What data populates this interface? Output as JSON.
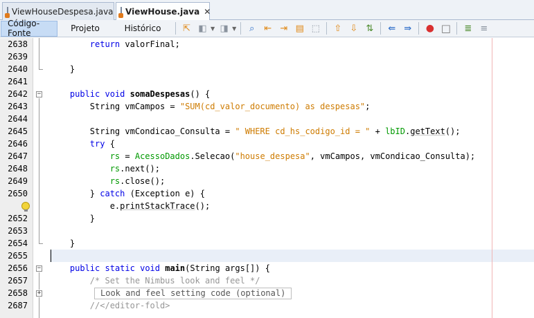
{
  "tabs": [
    {
      "label": "ViewHouseDespesa.java",
      "active": false
    },
    {
      "label": "ViewHouse.java",
      "active": true
    }
  ],
  "view_tabs": [
    "Código-Fonte",
    "Projeto",
    "Histórico"
  ],
  "code_lines": [
    {
      "num": "2638",
      "text": "        return valorFinal;"
    },
    {
      "num": "2639",
      "text": ""
    },
    {
      "num": "2640",
      "text": "    }"
    },
    {
      "num": "2641",
      "text": ""
    },
    {
      "num": "2642",
      "text": "    public void somaDespesas() {"
    },
    {
      "num": "2643",
      "text": "        String vmCampos = \"SUM(cd_valor_documento) as despesas\";"
    },
    {
      "num": "2644",
      "text": ""
    },
    {
      "num": "2645",
      "text": "        String vmCondicao_Consulta = \" WHERE cd_hs_codigo_id = \" + lbID.getText();"
    },
    {
      "num": "2646",
      "text": "        try {"
    },
    {
      "num": "2647",
      "text": "            rs = AcessoDados.Selecao(\"house_despesa\", vmCampos, vmCondicao_Consulta);"
    },
    {
      "num": "2648",
      "text": "            rs.next();"
    },
    {
      "num": "2649",
      "text": "            rs.close();"
    },
    {
      "num": "2650",
      "text": "        } catch (Exception e) {"
    },
    {
      "num": "",
      "text": "            e.printStackTrace();"
    },
    {
      "num": "2652",
      "text": "        }"
    },
    {
      "num": "2653",
      "text": ""
    },
    {
      "num": "2654",
      "text": "    }"
    },
    {
      "num": "2655",
      "text": ""
    },
    {
      "num": "2656",
      "text": "    public static void main(String args[]) {"
    },
    {
      "num": "2657",
      "text": "        /* Set the Nimbus look and feel */"
    },
    {
      "num": "2658",
      "text": "Look and feel setting code (optional)"
    },
    {
      "num": "2687",
      "text": "        //</editor-fold>"
    }
  ],
  "colors": {
    "keyword": "#0000e6",
    "string": "#ce7b00",
    "field": "#009900",
    "comment": "#969696"
  }
}
